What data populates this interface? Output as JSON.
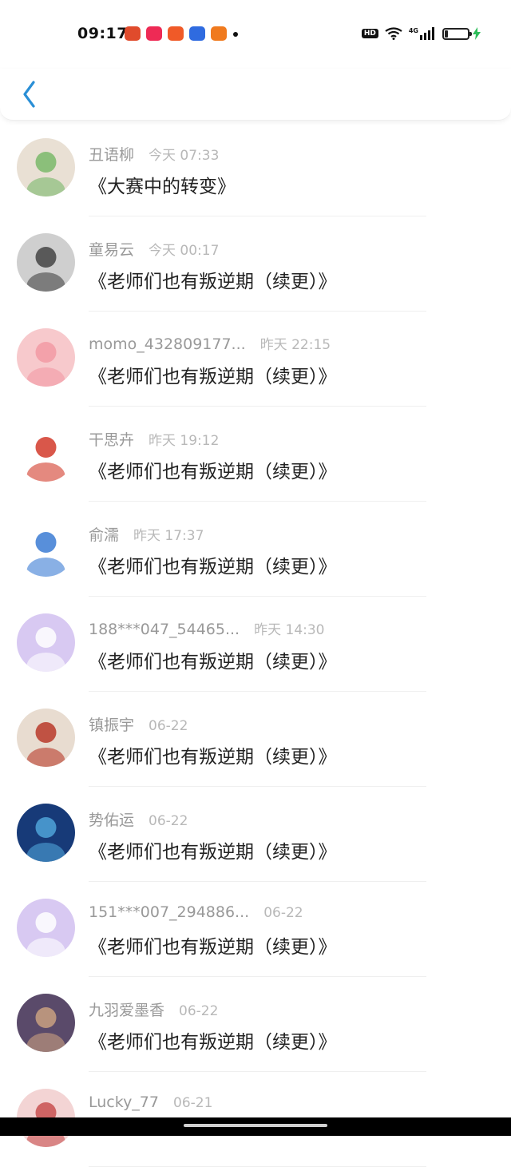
{
  "status_bar": {
    "time": "09:17",
    "hd_label": "HD",
    "network_label": "4G",
    "app_colors": [
      "#e04b2c",
      "#ee2a55",
      "#f05a28",
      "#2f6be0",
      "#f07a1e"
    ]
  },
  "header": {
    "back_icon": "chevron-left-icon",
    "accent": "#2a8fd6"
  },
  "messages": [
    {
      "name": "丑语柳",
      "time": "今天 07:33",
      "title": "《大赛中的转变》",
      "avatar": {
        "bg": "#e9e0d4",
        "accent": "#7ab86a"
      }
    },
    {
      "name": "童易云",
      "time": "今天 00:17",
      "title": "《老师们也有叛逆期（续更）》",
      "avatar": {
        "bg": "#cfcfcf",
        "accent": "#444444"
      }
    },
    {
      "name": "momo_432809177...",
      "time": "昨天 22:15",
      "title": "《老师们也有叛逆期（续更）》",
      "avatar": {
        "bg": "#f7c9cc",
        "accent": "#f29aa3"
      }
    },
    {
      "name": "干思卉",
      "time": "昨天 19:12",
      "title": "《老师们也有叛逆期（续更）》",
      "avatar": {
        "bg": "#ffffff",
        "accent": "#d23a2a"
      }
    },
    {
      "name": "俞濡",
      "time": "昨天 17:37",
      "title": "《老师们也有叛逆期（续更）》",
      "avatar": {
        "bg": "#ffffff",
        "accent": "#3b7bd4"
      }
    },
    {
      "name": "188***047_54465...",
      "time": "昨天 14:30",
      "title": "《老师们也有叛逆期（续更）》",
      "avatar": {
        "bg": "#d8c9f2",
        "accent": "#ffffff"
      }
    },
    {
      "name": "镇振宇",
      "time": "06-22",
      "title": "《老师们也有叛逆期（续更）》",
      "avatar": {
        "bg": "#e8dcd0",
        "accent": "#b83a2a"
      }
    },
    {
      "name": "势佑运",
      "time": "06-22",
      "title": "《老师们也有叛逆期（续更）》",
      "avatar": {
        "bg": "#173a78",
        "accent": "#4fa3d8"
      }
    },
    {
      "name": "151***007_294886...",
      "time": "06-22",
      "title": "《老师们也有叛逆期（续更）》",
      "avatar": {
        "bg": "#d8c9f2",
        "accent": "#ffffff"
      }
    },
    {
      "name": "九羽爱墨香",
      "time": "06-22",
      "title": "《老师们也有叛逆期（续更）》",
      "avatar": {
        "bg": "#5a4a6a",
        "accent": "#c9a080"
      }
    },
    {
      "name": "Lucky_77",
      "time": "06-21",
      "title": "",
      "avatar": {
        "bg": "#f3d4d4",
        "accent": "#c85050"
      }
    }
  ]
}
